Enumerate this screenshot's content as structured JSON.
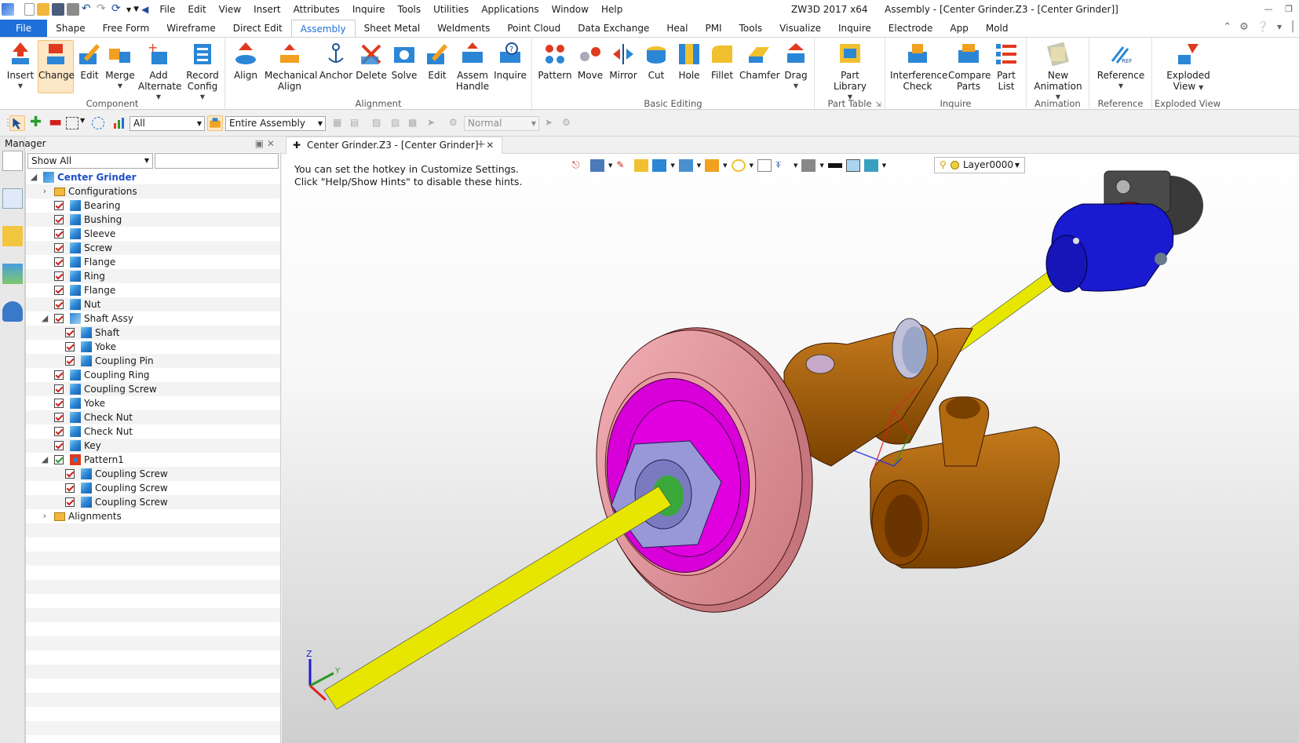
{
  "title_bar": {
    "window_title": "ZW3D 2017 x64",
    "document_title": "Assembly - [Center Grinder.Z3 - [Center Grinder]]",
    "menu": [
      "File",
      "Edit",
      "View",
      "Insert",
      "Attributes",
      "Inquire",
      "Tools",
      "Utilities",
      "Applications",
      "Window",
      "Help"
    ]
  },
  "tabs": [
    "File",
    "Shape",
    "Free Form",
    "Wireframe",
    "Direct Edit",
    "Assembly",
    "Sheet Metal",
    "Weldments",
    "Point Cloud",
    "Data Exchange",
    "Heal",
    "PMI",
    "Tools",
    "Visualize",
    "Inquire",
    "Electrode",
    "App",
    "Mold"
  ],
  "active_tab": "Assembly",
  "ribbon": {
    "component": {
      "label": "Component",
      "buttons": [
        "Insert",
        "Change",
        "Edit",
        "Merge",
        "Add Alternate",
        "Record Config"
      ]
    },
    "alignment": {
      "label": "Alignment",
      "buttons": [
        "Align",
        "Mechanical Align",
        "Anchor",
        "Delete",
        "Solve",
        "Edit",
        "Assem Handle",
        "Inquire"
      ]
    },
    "basic_editing": {
      "label": "Basic Editing",
      "buttons": [
        "Pattern",
        "Move",
        "Mirror",
        "Cut",
        "Hole",
        "Fillet",
        "Chamfer",
        "Drag"
      ]
    },
    "part_table": {
      "label": "Part Table",
      "buttons": [
        "Part Library"
      ]
    },
    "inquire": {
      "label": "Inquire",
      "buttons": [
        "Interference Check",
        "Compare Parts",
        "Part List"
      ]
    },
    "animation": {
      "label": "Animation",
      "buttons": [
        "New Animation"
      ]
    },
    "reference": {
      "label": "Reference",
      "buttons": [
        "Reference"
      ]
    },
    "exploded": {
      "label": "Exploded View",
      "buttons": [
        "Exploded View"
      ]
    }
  },
  "options_bar": {
    "filter": "All",
    "scope": "Entire Assembly",
    "mode": "Normal"
  },
  "manager": {
    "title": "Manager",
    "filter": "Show All",
    "tree": [
      {
        "label": "Center Grinder",
        "level": 0,
        "type": "root"
      },
      {
        "label": "Configurations",
        "level": 1,
        "type": "folder"
      },
      {
        "label": "Bearing",
        "level": 1,
        "type": "part"
      },
      {
        "label": "Bushing",
        "level": 1,
        "type": "part"
      },
      {
        "label": "Sleeve",
        "level": 1,
        "type": "part"
      },
      {
        "label": "Screw",
        "level": 1,
        "type": "part"
      },
      {
        "label": "Flange",
        "level": 1,
        "type": "part"
      },
      {
        "label": "Ring",
        "level": 1,
        "type": "part"
      },
      {
        "label": "Flange",
        "level": 1,
        "type": "part"
      },
      {
        "label": "Nut",
        "level": 1,
        "type": "part"
      },
      {
        "label": "Shaft Assy",
        "level": 1,
        "type": "assy"
      },
      {
        "label": "Shaft",
        "level": 2,
        "type": "part"
      },
      {
        "label": "Yoke",
        "level": 2,
        "type": "part"
      },
      {
        "label": "Coupling Pin",
        "level": 2,
        "type": "part"
      },
      {
        "label": "Coupling Ring",
        "level": 1,
        "type": "part"
      },
      {
        "label": "Coupling Screw",
        "level": 1,
        "type": "part"
      },
      {
        "label": "Yoke",
        "level": 1,
        "type": "part"
      },
      {
        "label": "Check Nut",
        "level": 1,
        "type": "part"
      },
      {
        "label": "Check Nut",
        "level": 1,
        "type": "part"
      },
      {
        "label": "Key",
        "level": 1,
        "type": "part"
      },
      {
        "label": "Pattern1",
        "level": 1,
        "type": "pattern"
      },
      {
        "label": "Coupling Screw",
        "level": 2,
        "type": "part"
      },
      {
        "label": "Coupling Screw",
        "level": 2,
        "type": "part"
      },
      {
        "label": "Coupling Screw",
        "level": 2,
        "type": "part"
      },
      {
        "label": "Alignments",
        "level": 1,
        "type": "folder"
      }
    ]
  },
  "document": {
    "tab": "Center Grinder.Z3 - [Center Grinder]",
    "hint_line1": "You can set the hotkey in Customize Settings.",
    "hint_line2": "Click \"Help/Show Hints\" to disable these hints.",
    "layer": "Layer0000"
  },
  "triad": {
    "z": "Z",
    "y": "Y"
  },
  "colors": {
    "accent": "#1e6fd9",
    "shaft": "#e6e600",
    "disc": "#e89aa0",
    "hub": "#e000e0",
    "body": "#a55a00",
    "yoke": "#1a1ad0"
  }
}
